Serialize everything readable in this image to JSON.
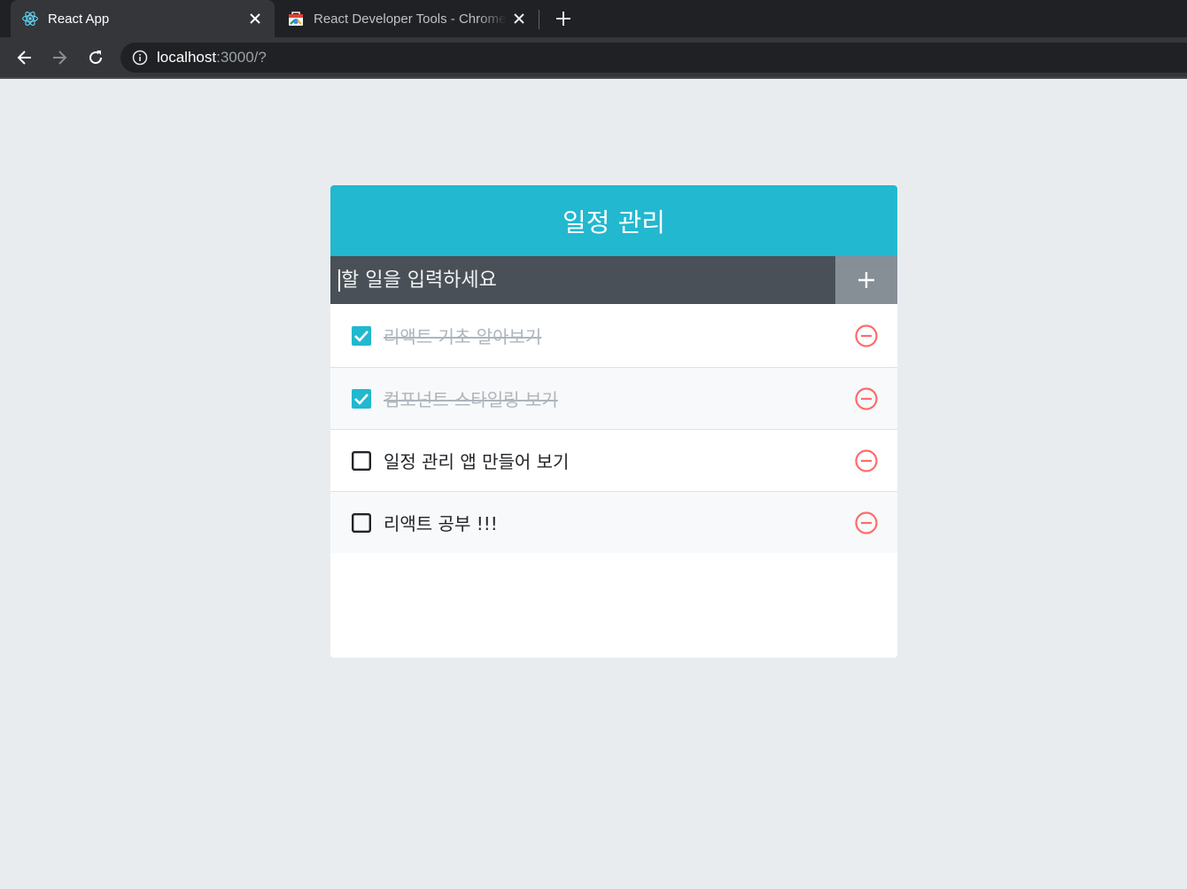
{
  "browser": {
    "tabs": [
      {
        "title": "React App",
        "favicon": "react-logo-icon",
        "active": true
      },
      {
        "title": "React Developer Tools - Chrome Web Store",
        "favicon": "chrome-web-store-icon",
        "active": false
      }
    ],
    "address": {
      "host": "localhost",
      "rest": ":3000/?"
    },
    "icons": {
      "back": "arrow-left-icon",
      "forward": "arrow-right-icon",
      "reload": "reload-icon",
      "info": "info-icon",
      "close": "close-icon",
      "new_tab": "plus-icon"
    }
  },
  "app": {
    "title": "일정 관리",
    "insert": {
      "placeholder": "할 일을 입력하세요",
      "value": "",
      "button_icon": "plus-icon"
    },
    "todos": [
      {
        "text": "리액트 기초 알아보기",
        "checked": true
      },
      {
        "text": "컴포넌트 스타일링 보기",
        "checked": true
      },
      {
        "text": "일정 관리 앱 만들어 보기",
        "checked": false
      },
      {
        "text": "리액트 공부 !!!",
        "checked": false
      }
    ]
  },
  "colors": {
    "page_background": "#e9ecef",
    "header": "#22b8cf",
    "insert_bar": "#495057",
    "insert_button": "#868e96",
    "checked_box": "#22b8cf",
    "remove_icon": "#ff6b6b",
    "checked_text": "#adb5bd"
  }
}
